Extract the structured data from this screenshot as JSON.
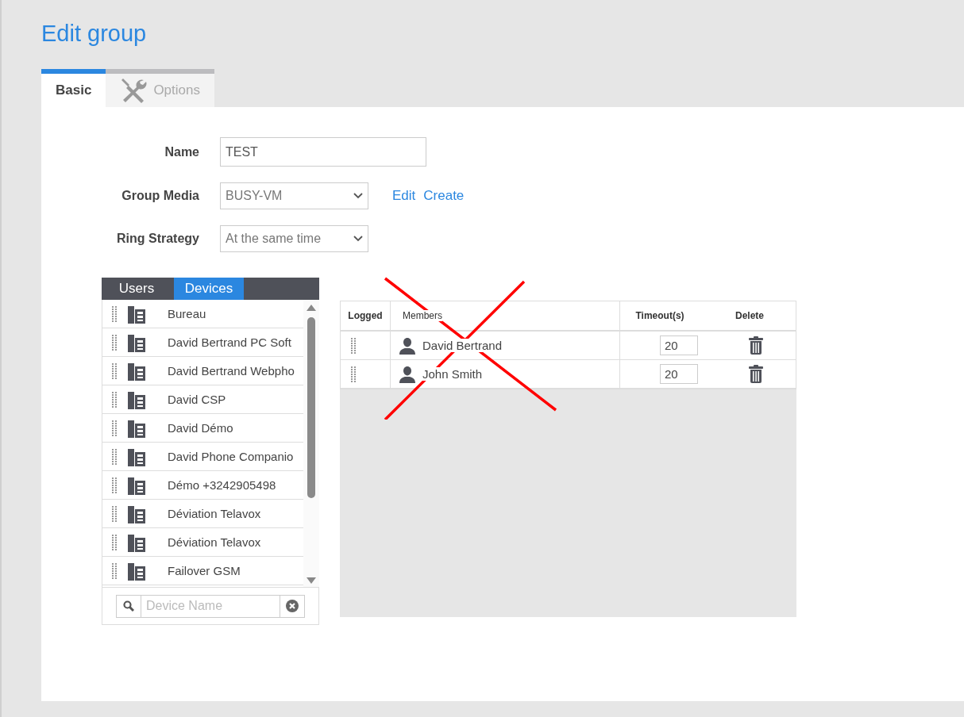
{
  "title": "Edit group",
  "tabs": [
    {
      "label": "Basic",
      "selected": true,
      "kind": "plain"
    },
    {
      "label": "Options",
      "selected": false,
      "kind": "tools"
    }
  ],
  "form": {
    "name": {
      "label": "Name",
      "value": "TEST"
    },
    "group_media": {
      "label": "Group Media",
      "value": "BUSY-VM",
      "links": [
        "Edit",
        "Create"
      ]
    },
    "ring_strategy": {
      "label": "Ring Strategy",
      "value": "At the same time"
    }
  },
  "source_tabs": [
    {
      "label": "Users",
      "selected": false
    },
    {
      "label": "Devices",
      "selected": true
    }
  ],
  "devices": [
    {
      "name": "Bureau"
    },
    {
      "name": "David Bertrand PC Soft"
    },
    {
      "name": "David Bertrand Webpho"
    },
    {
      "name": "David CSP"
    },
    {
      "name": "David Démo"
    },
    {
      "name": "David Phone Companio"
    },
    {
      "name": "Démo +3242905498"
    },
    {
      "name": "Déviation Telavox"
    },
    {
      "name": "Déviation Telavox"
    },
    {
      "name": "Failover GSM"
    }
  ],
  "device_search": {
    "placeholder": "Device Name"
  },
  "members_table": {
    "columns": [
      "Logged",
      "Members",
      "Timeout(s)",
      "Delete"
    ],
    "rows": [
      {
        "member": "David Bertrand",
        "timeout": "20"
      },
      {
        "member": "John Smith",
        "timeout": "20"
      }
    ]
  },
  "crossed_out": true
}
